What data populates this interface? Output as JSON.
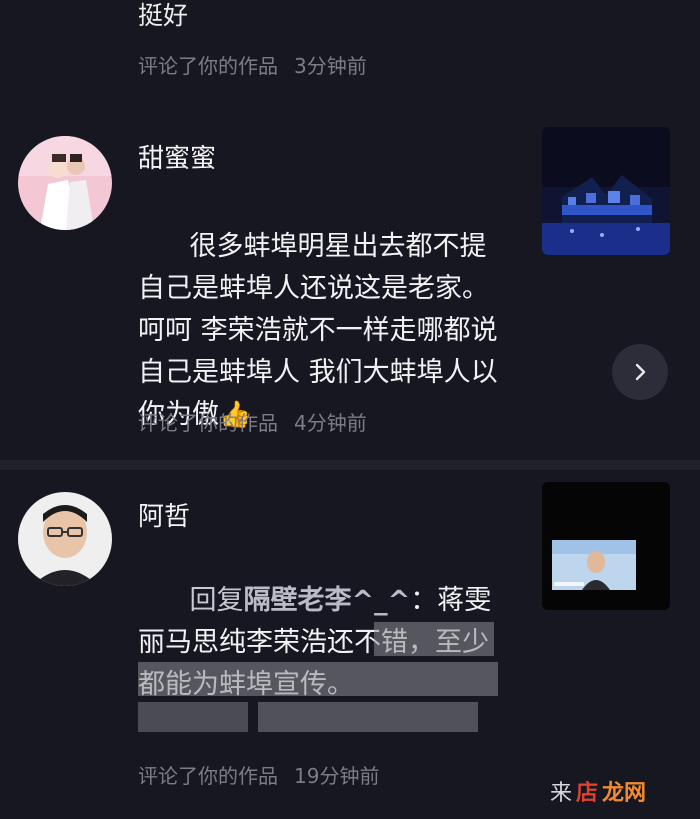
{
  "top_comment": {
    "text": "挺好",
    "action": "评论了你的作品",
    "time": "3分钟前"
  },
  "comments": [
    {
      "user": "甜蜜蜜",
      "text": "很多蚌埠明星出去都不提自己是蚌埠人还说这是老家。呵呵 李荣浩就不一样走哪都说自己是蚌埠人 我们大蚌埠人以你为傲",
      "emoji": "👍",
      "action": "评论了你的作品",
      "time": "4分钟前"
    },
    {
      "user": "阿哲",
      "reply_prefix": "回复",
      "reply_to": "隔壁老李^_^",
      "reply_colon": "：",
      "text": "蒋雯丽马思纯李荣浩还不错，至少都能为蚌埠宣传。",
      "action": "评论了你的作品",
      "time": "19分钟前"
    }
  ],
  "arrow_icon": "chevron-right-icon",
  "watermark": {
    "text_a": "来",
    "text_b": "店",
    "text_c": "龙网"
  }
}
